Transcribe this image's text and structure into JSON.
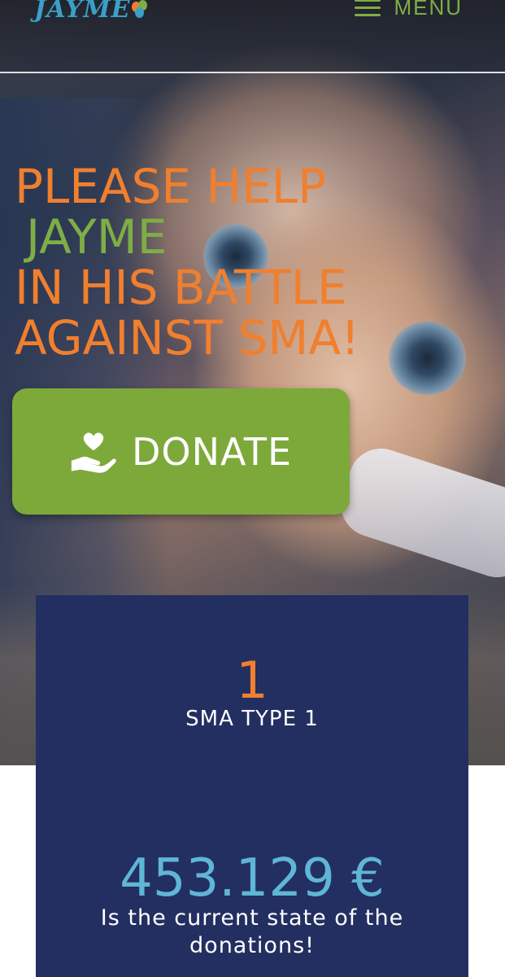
{
  "header": {
    "logo_text": "JAYME",
    "menu_label": "MENU"
  },
  "hero": {
    "headline_line1": "PLEASE HELP",
    "headline_name": "JAYME",
    "headline_line3": "IN HIS BATTLE",
    "headline_line4": "AGAINST SMA!",
    "donate_label": "DONATE"
  },
  "stats": {
    "count": "1",
    "count_label": "SMA TYPE 1",
    "donation_amount": "453.129 €",
    "donation_text": "Is the current state of the donations!"
  },
  "colors": {
    "accent_orange": "#f07f2e",
    "accent_green": "#7da93b",
    "navy": "#232f61",
    "light_blue": "#5fb6d6"
  },
  "icons": {
    "menu": "hamburger-icon",
    "donate": "heart-hand-icon"
  }
}
